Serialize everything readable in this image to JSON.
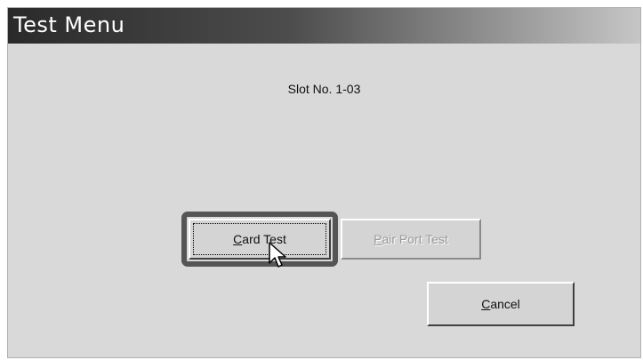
{
  "window": {
    "title": "Test Menu"
  },
  "dialog": {
    "slot_label": "Slot No.  1-03"
  },
  "buttons": {
    "card_test": {
      "mnemonic": "C",
      "rest": "ard Test",
      "focused": true
    },
    "pair_port_test": {
      "mnemonic": "P",
      "rest": "air Port Test",
      "enabled": false
    },
    "cancel": {
      "mnemonic": "C",
      "rest": "ancel"
    }
  },
  "icons": {
    "cursor": "mouse-pointer-icon"
  },
  "colors": {
    "title_bar_dark": "#2a2a2a",
    "title_bar_light": "#c6c6c6",
    "dialog_background": "#d9d9d9",
    "focus_frame": "#555555",
    "disabled_text": "#9a9a9a"
  }
}
